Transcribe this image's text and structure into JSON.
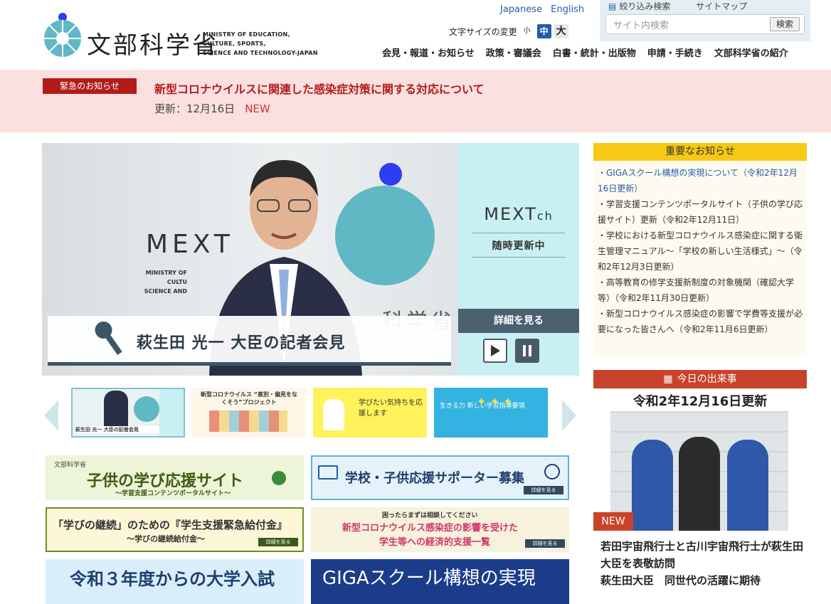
{
  "header": {
    "logo_jp": "文部科学省",
    "logo_en_lines": [
      "MINISTRY OF EDUCATION,",
      "CULTURE, SPORTS,",
      "SCIENCE AND TECHNOLOGY-JAPAN"
    ],
    "lang_japanese": "Japanese",
    "lang_english": "English",
    "fontsize_label": "文字サイズの変更",
    "fontsize_small": "小",
    "fontsize_mid": "中",
    "fontsize_large": "大",
    "search_filter": "絞り込み検索",
    "sitemap": "サイトマップ",
    "search_placeholder": "サイト内検索",
    "search_button": "検索",
    "nav": [
      "会見・報道・お知らせ",
      "政策・審議会",
      "白書・統計・出版物",
      "申請・手続き",
      "文部科学省の紹介"
    ]
  },
  "emergency": {
    "label": "緊急のお知らせ",
    "title": "新型コロナウイルスに関連した感染症対策に関する対応について",
    "updated": "更新：12月16日",
    "new": "NEW"
  },
  "hero": {
    "mext": "MEXT",
    "ministry_lines": [
      "MINISTRY OF",
      "CULTU",
      "SCIENCE AND"
    ],
    "side_title": "MEXT",
    "side_title_suffix": "ch",
    "side_sub": "随時更新中",
    "side_detail": "詳細を見る",
    "caption": "萩生田 光一 大臣の記者会見",
    "partial_text": "科学省"
  },
  "thumbs": [
    {
      "label": "萩生田 光一 大臣の記者会見"
    },
    {
      "label": "新型コロナウイルス “差別・偏見をなくそう”プロジェクト"
    },
    {
      "label": "学びたい気持ちを応援します"
    },
    {
      "label": "生きる力 新しい学習指導要領"
    }
  ],
  "banners": {
    "b1_brand": "文部科学省",
    "b1_title": "子供の学び応援サイト",
    "b1_sub": "〜学習支援コンテンツポータルサイト〜",
    "b2_title": "学校・子供応援サポーター募集",
    "b2_btn": "詳細を見る",
    "b3_title": "「学びの継続」のための『学生支援緊急給付金』",
    "b3_sub": "〜学びの継続給付金〜",
    "b3_btn": "詳細を見る",
    "b4_top": "困ったらまずは相談してください",
    "b4_title1": "新型コロナウイルス感染症の影響を受けた",
    "b4_title2": "学生等への経済的支援一覧",
    "b4_btn": "詳細を見る",
    "b5_title": "令和３年度からの大学入試",
    "b6_title": "GIGAスクール構想の実現"
  },
  "notice": {
    "header": "重要なお知らせ",
    "items": [
      {
        "text": "・GIGAスクール構想の実現について（令和2年12月16日更新）"
      },
      {
        "text": "・学習支援コンテンツポータルサイト（子供の学び応援サイト）更新（令和2年12月11日）"
      },
      {
        "text": "・学校における新型コロナウイルス感染症に関する衛生管理マニュアル～「学校の新しい生活様式」～（令和2年12月3日更新）"
      },
      {
        "text": "・高等教育の修学支援新制度の対象機関（確認大学等）（令和2年11月30日更新）"
      },
      {
        "text": "・新型コロナウイルス感染症の影響で学費等支援が必要になった皆さんへ（令和2年11月6日更新）"
      }
    ]
  },
  "today": {
    "header": "今日の出来事",
    "date": "令和2年12月16日更新",
    "new": "NEW",
    "text": "若田宇宙飛行士と古川宇宙飛行士が萩生田大臣を表敬訪問",
    "text2": "萩生田大臣　同世代の活躍に期待"
  },
  "colors": {
    "brand_teal": "#5fb8c4",
    "brand_blue": "#2b3ef0",
    "emergency_red": "#b31b1b",
    "notice_yellow": "#f6ca14",
    "today_red": "#c9432a"
  }
}
